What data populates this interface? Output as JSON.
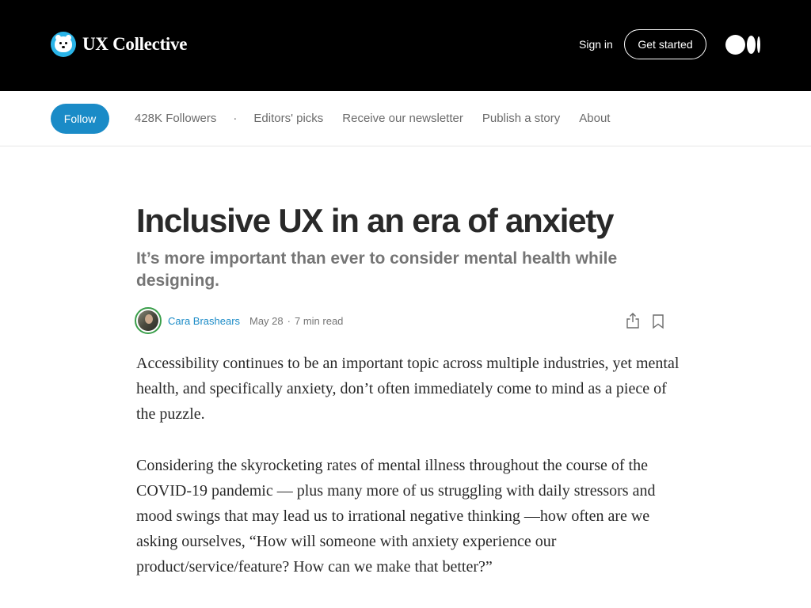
{
  "header": {
    "brand_name": "UX Collective",
    "brand_logo_icon": "polar-bear-logo-icon",
    "sign_in_label": "Sign in",
    "get_started_label": "Get started",
    "medium_logo_icon": "medium-logo-icon"
  },
  "publication_nav": {
    "follow_label": "Follow",
    "followers": "428K Followers",
    "separator": "·",
    "links": [
      "Editors' picks",
      "Receive our newsletter",
      "Publish a story",
      "About"
    ]
  },
  "article": {
    "title": "Inclusive UX in an era of anxiety",
    "subtitle": "It’s more important than ever to consider mental health while designing.",
    "author": "Cara Brashears",
    "date": "May 28",
    "dot": "·",
    "read_time": "7 min read",
    "paragraphs": [
      "Accessibility continues to be an important topic across multiple industries, yet mental health, and specifically anxiety, don’t often immediately come to mind as a piece of the puzzle.",
      "Considering the skyrocketing rates of mental illness throughout the course of the COVID-19 pandemic — plus many more of us struggling with daily stressors and mood swings that may lead us to irrational negative thinking —how often are we asking ourselves, “How will someone with anxiety experience our product/service/feature? How can we make that better?”"
    ]
  },
  "colors": {
    "header_bg": "#000000",
    "follow_bg": "#1a8bc7",
    "author_link": "#1a8bc7",
    "brand_logo_bg": "#2ab4e8"
  }
}
